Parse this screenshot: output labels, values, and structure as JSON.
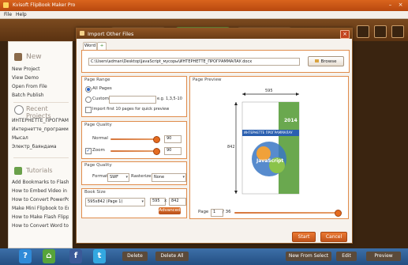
{
  "app": {
    "title": "Kvisoft FlipBook Maker Pro"
  },
  "menu": {
    "file": "File",
    "help": "Help"
  },
  "sidebar": {
    "new_heading": "New",
    "new_items": [
      "New Project",
      "View Demo",
      "Open From File",
      "Batch Publish"
    ],
    "recent_heading": "Recent Projects",
    "recent_items": [
      "ИНТЕРНЕТТЕ_ПРОГРАММА",
      "Интернетте_программала",
      "Мысал",
      "Электр_баяндама"
    ],
    "tutorials_heading": "Tutorials",
    "tutorial_items": [
      "Add Bookmarks to Flash Fa",
      "How to Embed Video in HT",
      "How to Convert PowerPoi",
      "Make Mini Flipbook to Embe",
      "How to Make Flash Flipping",
      "How to Convert Word to H"
    ]
  },
  "bottom": {
    "delete": "Delete",
    "delete_all": "Delete All",
    "new_from_select": "New From Select",
    "edit": "Edit",
    "preview": "Preview"
  },
  "dialog": {
    "title": "Import Other Files",
    "tabs": [
      "Word"
    ],
    "file_path": "C:\\Users\\adman\\Desktop\\JavaScript_мусоры\\ИНТЕРНЕТТЕ_ПРОГРАММАЛАУ.docx",
    "browse": "Browse",
    "page_range": {
      "title": "Page Range",
      "all_pages": "All Pages",
      "custom": "Custom",
      "custom_value": "",
      "custom_hint": "e.g. 1,3,5-10",
      "first10": "Import first 10 pages for quick preview"
    },
    "page_quality1": {
      "title": "Page Quality",
      "normal_label": "Normal",
      "normal_value": "90",
      "normal_level": 0.92,
      "zoom_label": "Zoom",
      "zoom_value": "90",
      "zoom_level": 0.92
    },
    "page_quality2": {
      "title": "Page Quality",
      "format_label": "Format",
      "format_value": "SWF",
      "rasterize_label": "Rasterize",
      "rasterize_value": "None"
    },
    "book_size": {
      "title": "Book Size",
      "select_value": "595x842 (Page 1)",
      "width": "595",
      "x": "x",
      "height": "842"
    },
    "advanced": "Advanced",
    "page_preview": {
      "title": "Page Preview",
      "width_label": "595",
      "height_label": "842",
      "book_year": "2014",
      "book_title": "ИНТЕРНЕТТЕ ПРОГРАММАЛАУ",
      "book_logo": "JavaScript",
      "page_label": "Page",
      "page_value": "1",
      "page_total": "/ 36"
    },
    "start": "Start",
    "cancel": "Cancel"
  },
  "colors": {
    "accent": "#e56b1f",
    "bottombar": "#2f5f97",
    "dialog_header": "#7c4a1d"
  }
}
